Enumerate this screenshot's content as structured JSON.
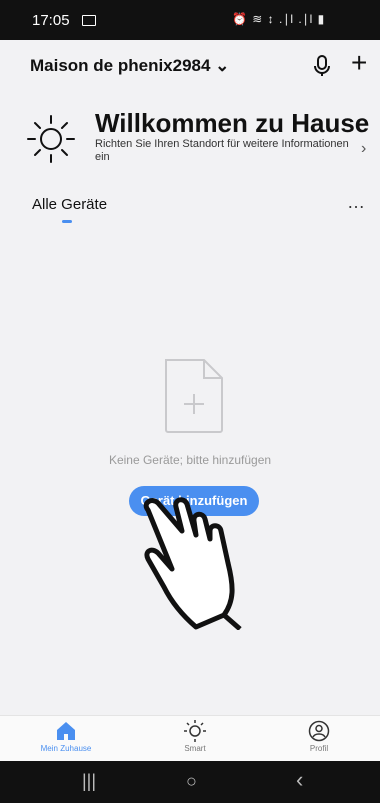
{
  "status_bar": {
    "time": "17:05",
    "icons": "⏰ ≋ ↕ .∣l .∣l ▮"
  },
  "header": {
    "home_name": "Maison de phenix2984 ⌄",
    "add_symbol": "+"
  },
  "welcome": {
    "title": "Willkommen zu Hause",
    "subtitle": "Richten Sie Ihren Standort für weitere Informationen ein",
    "chevron": "›"
  },
  "tabs": {
    "active": "Alle Geräte",
    "more": "…"
  },
  "empty_state": {
    "message": "Keine Geräte; bitte hinzufügen",
    "button_label": "Gerät hinzufügen"
  },
  "bottom_nav": {
    "items": [
      {
        "label": "Mein Zuhause",
        "icon": "home-icon",
        "active": true
      },
      {
        "label": "Smart",
        "icon": "sun-icon",
        "active": false
      },
      {
        "label": "Profil",
        "icon": "profile-icon",
        "active": false
      }
    ]
  },
  "system_nav": {
    "recent": "|||",
    "home": "○",
    "back": "‹"
  },
  "colors": {
    "accent": "#4a8ff0",
    "background": "#f2f2f4"
  }
}
